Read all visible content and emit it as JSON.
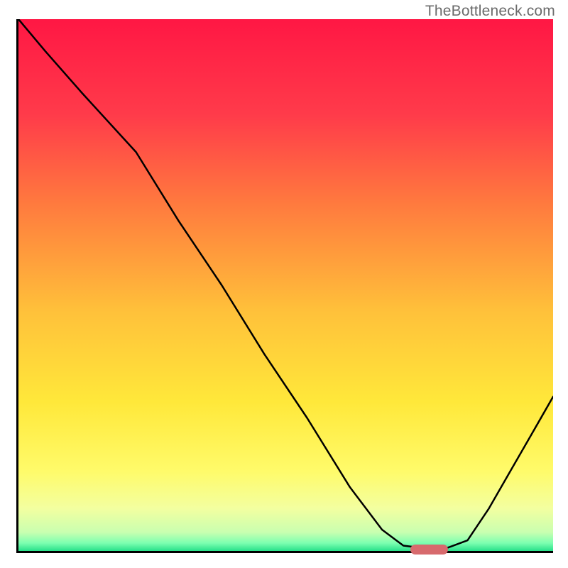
{
  "watermark": "TheBottleneck.com",
  "chart_data": {
    "type": "line",
    "title": "",
    "xlabel": "",
    "ylabel": "",
    "xlim": [
      0,
      100
    ],
    "ylim": [
      0,
      100
    ],
    "x": [
      0,
      5,
      12,
      22,
      30,
      38,
      46,
      54,
      62,
      68,
      72,
      76,
      80,
      84,
      88,
      92,
      96,
      100
    ],
    "values": [
      100,
      94,
      86,
      75,
      62,
      50,
      37,
      25,
      12,
      4,
      1,
      0.5,
      0.5,
      2,
      8,
      15,
      22,
      29
    ],
    "marker": {
      "x_start": 73,
      "x_end": 80,
      "y": 0.7
    },
    "gradient_stops": [
      {
        "pos": 0.0,
        "color": "#ff1744"
      },
      {
        "pos": 0.18,
        "color": "#ff3b4a"
      },
      {
        "pos": 0.35,
        "color": "#ff7b3e"
      },
      {
        "pos": 0.55,
        "color": "#ffc13a"
      },
      {
        "pos": 0.72,
        "color": "#ffe83a"
      },
      {
        "pos": 0.85,
        "color": "#fffb6a"
      },
      {
        "pos": 0.92,
        "color": "#f3ffa0"
      },
      {
        "pos": 0.965,
        "color": "#c9ffb0"
      },
      {
        "pos": 0.985,
        "color": "#7dffb0"
      },
      {
        "pos": 1.0,
        "color": "#27e08a"
      }
    ]
  }
}
